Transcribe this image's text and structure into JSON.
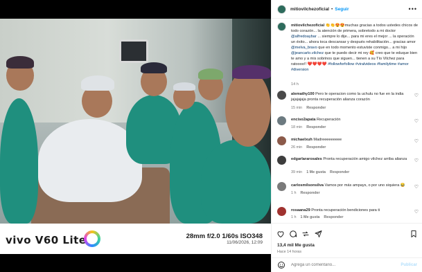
{
  "post": {
    "username": "mitiovilchezoficial",
    "follow_label": "Seguir",
    "caption_user": "mitiovilchezoficial",
    "caption_parts": [
      " 👏👏😍😍muchas gracias a todos ustedes chicos de todo corazón... la atención de primera, sobretodo a mi doctor ",
      "@alfredoaybar",
      " ... siempre lo dije... para mi eres el mejor ... la operación un éxito... ahora toca descansar y después rehabilitación... gracias amor ",
      "@melva_bravo",
      " que en todo momento estuviste conmigo... a mi hijo ",
      "@jeancarlo.vilchez",
      " que te puedo decir mi rey 🥰 creo que te eduque bien te amo y a mis sobrinos que siguen... tienen a su Tío Vilchez para ratoooo!! ❤️❤️❤️❤️ ",
      "#followforfollow #viralvideos #familytime #amor #diversion"
    ],
    "caption_time": "14 h"
  },
  "comments": [
    {
      "user": "alemathy100",
      "text": "Pero le operacion como la uchulu no fue en la india jajajajaja pronta recuperación alianza corazón",
      "time": "15 min",
      "reply": "Responder",
      "likes": "",
      "avatar_color": "#4a4a4a"
    },
    {
      "user": "enciso2apata",
      "text": "Recuperación",
      "time": "18 min",
      "reply": "Responder",
      "likes": "",
      "avatar_color": "#6c7a80"
    },
    {
      "user": "michaelxuh",
      "text": "Madreeeeeeeee",
      "time": "26 min",
      "reply": "Responder",
      "likes": "",
      "avatar_color": "#8b5a4a"
    },
    {
      "user": "edgarlararosales",
      "text": "Pronta recuperación amigo vilchez arriba alianza",
      "time": "39 min",
      "reply": "Responder",
      "likes": "1 Me gusta",
      "avatar_color": "#3d3d3d"
    },
    {
      "user": "carlosmilsonsilva",
      "text": "Vamos por más ampays, o por uno siquiera 😂",
      "time": "1 h",
      "reply": "Responder",
      "likes": "",
      "avatar_color": "#7a7a7a"
    },
    {
      "user": "rosaana29",
      "text": "Pronta recuperación bendiciones para ti",
      "time": "1 h",
      "reply": "Responder",
      "likes": "1 Me gusta",
      "avatar_color": "#a0322f"
    }
  ],
  "actions": {
    "likes": "13,4 mil Me gusta",
    "time": "Hace 14 horas"
  },
  "comment_box": {
    "placeholder": "Agrega un comentario...",
    "publish": "Publicar"
  },
  "photo": {
    "brand": "vivo V60 Lite",
    "specs": "28mm  f/2.0  1/60s  ISO348",
    "date": "11/06/2026, 12:09"
  }
}
